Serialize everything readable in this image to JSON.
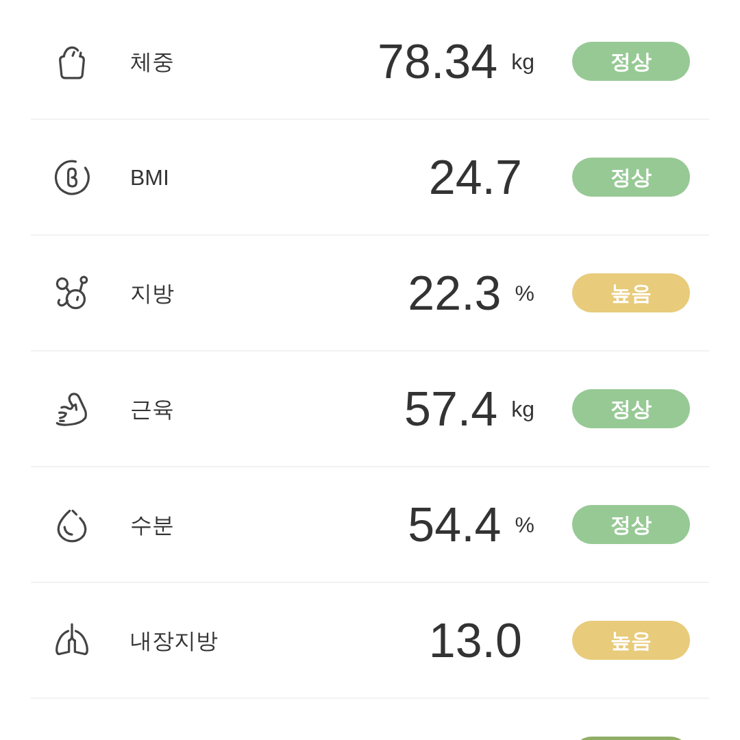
{
  "rows": [
    {
      "kind": "weight",
      "label": "체중",
      "value": "78.34",
      "unit": "kg",
      "status": {
        "label": "정상",
        "color": "#97c995"
      }
    },
    {
      "kind": "bmi",
      "label": "BMI",
      "value": "24.7",
      "status": {
        "label": "정상",
        "color": "#97c995"
      }
    },
    {
      "kind": "fat",
      "label": "지방",
      "value": "22.3",
      "unit": "%",
      "status": {
        "label": "높음",
        "color": "#e8cb7b"
      }
    },
    {
      "kind": "muscle",
      "label": "근육",
      "value": "57.4",
      "unit": "kg",
      "status": {
        "label": "정상",
        "color": "#97c995"
      }
    },
    {
      "kind": "water",
      "label": "수분",
      "value": "54.4",
      "unit": "%",
      "status": {
        "label": "정상",
        "color": "#97c995"
      }
    },
    {
      "kind": "visceral",
      "label": "내장지방",
      "value": "13.0",
      "status": {
        "label": "높음",
        "color": "#e8cb7b"
      }
    }
  ],
  "cut_off_row": {
    "status": {
      "color": "#8fae66"
    }
  }
}
